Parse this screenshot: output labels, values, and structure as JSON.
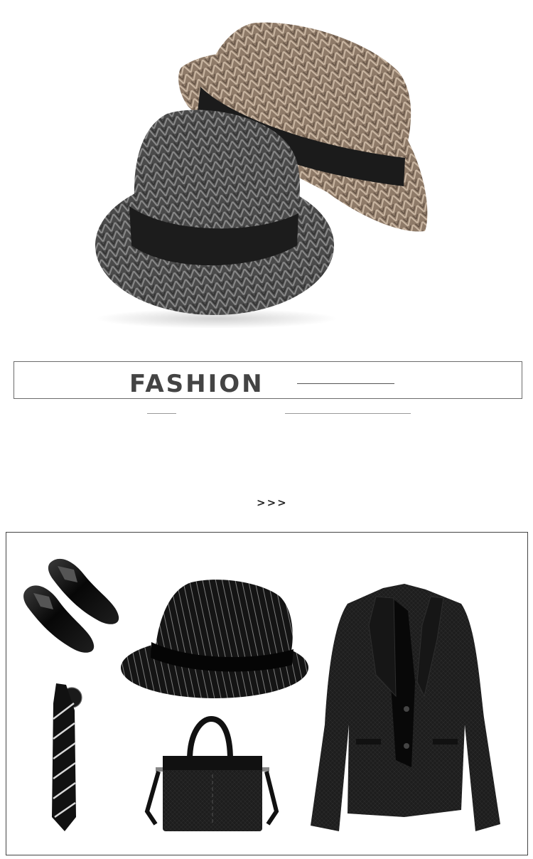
{
  "banner": {
    "title": "FASHION"
  },
  "nav": {
    "chevrons": ">>>"
  },
  "products": {
    "hat_colors": [
      "grey-herringbone",
      "khaki-herringbone"
    ],
    "outfit_items": [
      "shoes-icon",
      "tie-icon",
      "pinstripe-hat-icon",
      "briefcase-icon",
      "blazer-icon"
    ]
  }
}
